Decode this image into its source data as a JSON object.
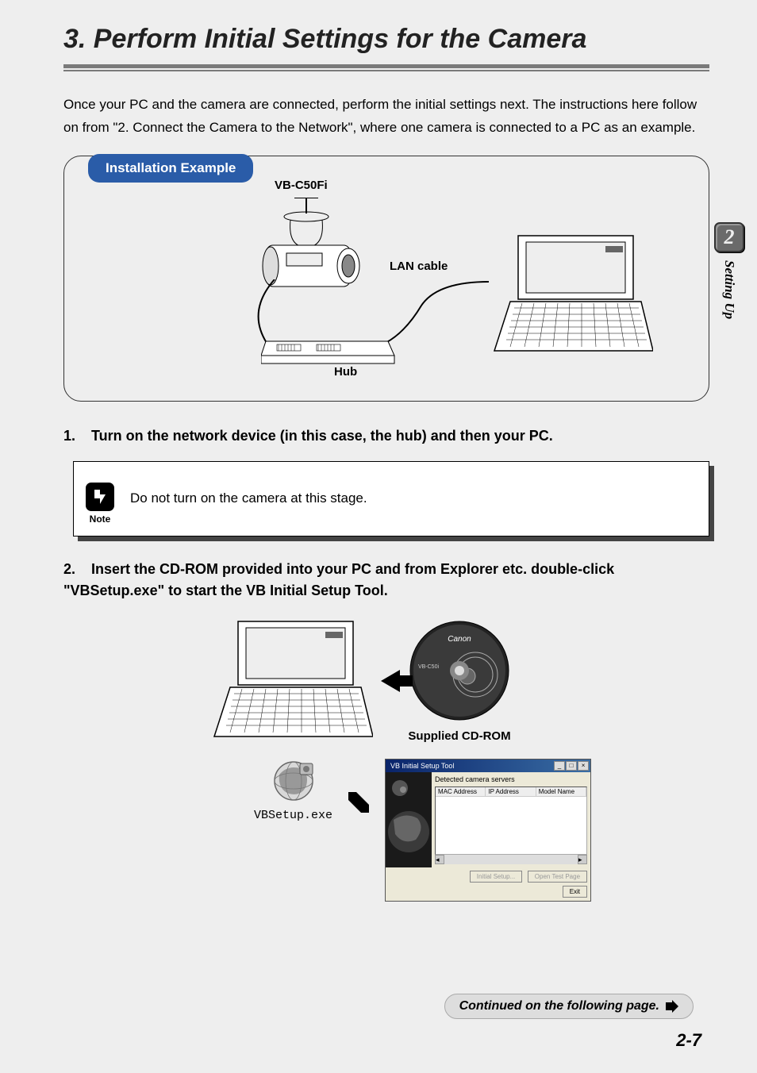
{
  "header": {
    "title": "3. Perform Initial Settings for the Camera"
  },
  "side": {
    "chapter": "2",
    "label": "Setting Up"
  },
  "intro": "Once your PC and the camera are connected, perform the initial settings next. The instructions here follow on from \"2. Connect the Camera to the Network\", where one camera is connected to a PC as an example.",
  "diagram": {
    "badge": "Installation Example",
    "camera": "VB-C50Fi",
    "lan": "LAN cable",
    "hub": "Hub"
  },
  "step1": {
    "num": "1.",
    "text": "Turn on the network device (in this case, the hub) and then your PC."
  },
  "note": {
    "label": "Note",
    "text": "Do not turn on the camera at this stage."
  },
  "step2": {
    "num": "2.",
    "text": "Insert the CD-ROM provided into your PC and from Explorer etc. double-click \"VBSetup.exe\" to start the VB Initial Setup Tool."
  },
  "figures": {
    "cd_label": "Supplied CD-ROM",
    "cd_brand": "Canon",
    "cd_model": "VB-C50i",
    "vbsetup_label": "VBSetup.exe"
  },
  "dialog": {
    "title": "VB Initial Setup Tool",
    "caption": "Detected camera servers",
    "columns": {
      "c1": "MAC Address",
      "c2": "IP Address",
      "c3": "Model Name"
    },
    "buttons": {
      "b1": "Initial Setup...",
      "b2": "Open Test Page",
      "b3": "Exit"
    }
  },
  "footer": {
    "continued": "Continued on the following page.",
    "page_num": "2-7"
  }
}
